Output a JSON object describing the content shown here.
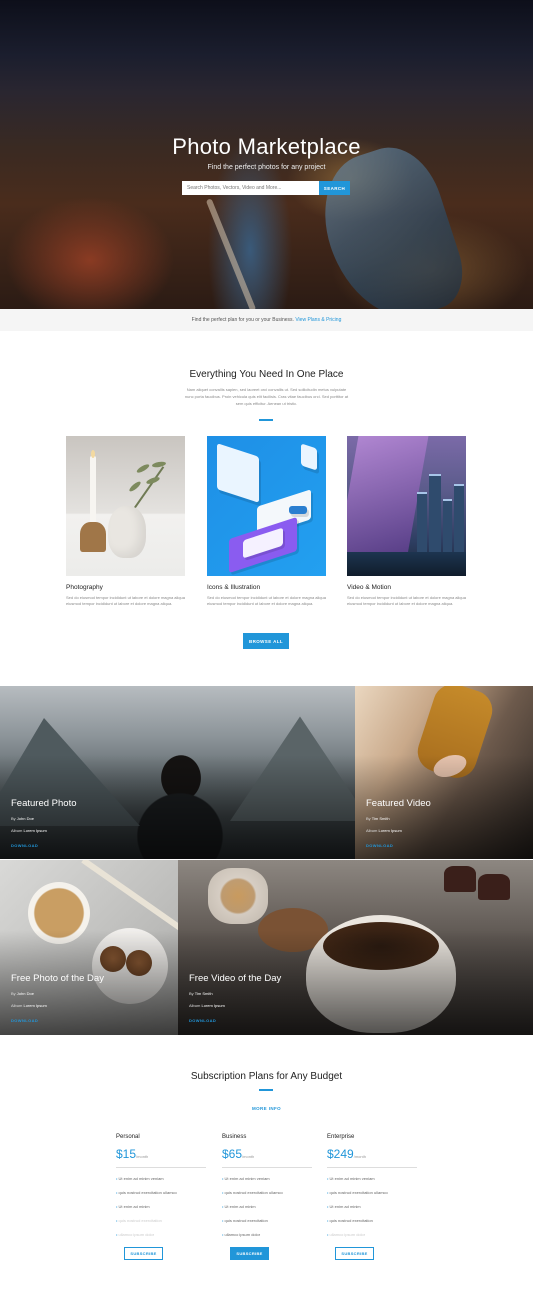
{
  "hero": {
    "title": "Photo Marketplace",
    "subtitle": "Find the perfect photos for any project",
    "search_placeholder": "Search Photos, Vectors, Video and More...",
    "search_button": "SEARCH"
  },
  "plans_bar": {
    "text": "Find the perfect plan for you or your Business.",
    "link": "View Plans & Pricing"
  },
  "features": {
    "title": "Everything You Need In One Place",
    "description": "Nam aliquet convallis sapien, sed laoreet orci convallis ut. Sed sollicitudin metus vulputate nunc porta faucibus. Proin vehicula quis elit facilisis. Cras vitae faucibus orci. Sed porttitor at sem quis efficitur. Aenean ut tristic.",
    "cards": [
      {
        "title": "Photography",
        "text": "Sed do eiusmod tempor incididunt ut labore et dolore magna aliqua eiusmod tempor incididunt ut labore et dolore magna aliqua."
      },
      {
        "title": "Icons & Illustration",
        "text": "Sed do eiusmod tempor incididunt ut labore et dolore magna aliqua eiusmod tempor incididunt ut labore et dolore magna aliqua."
      },
      {
        "title": "Video & Motion",
        "text": "Sed do eiusmod tempor incididunt ut labore et dolore magna aliqua eiusmod tempor incididunt ut labore et dolore magna aliqua."
      }
    ],
    "browse_button": "BROWSE ALL"
  },
  "featured": [
    {
      "title": "Featured Photo",
      "by_label": "By",
      "author": "John Doe",
      "album_label": "Album",
      "album": "Lorem Ipsum",
      "download": "DOWNLOAD"
    },
    {
      "title": "Featured Video",
      "by_label": "By",
      "author": "Tim Smith",
      "album_label": "Album",
      "album": "Lorem Ipsum",
      "download": "DOWNLOAD"
    },
    {
      "title": "Free Photo of the Day",
      "by_label": "By",
      "author": "John Doe",
      "album_label": "Album",
      "album": "Lorem Ipsum",
      "download": "DOWNLOAD"
    },
    {
      "title": "Free Video of the Day",
      "by_label": "By",
      "author": "Tim Smith",
      "album_label": "Album",
      "album": "Lorem Ipsum",
      "download": "DOWNLOAD"
    }
  ],
  "pricing": {
    "title": "Subscription Plans for Any Budget",
    "more_info": "MORE INFO",
    "plans": [
      {
        "name": "Personal",
        "price": "$15",
        "period": "/month",
        "features": [
          "Ut enim ad minim veniam",
          "quis nostrud exercitation ullamco",
          "Ut enim ad minim",
          "quis nostrud exercitation",
          "ullamco ipsum dolor"
        ],
        "button": "SUBSCRIBE"
      },
      {
        "name": "Business",
        "price": "$65",
        "period": "/month",
        "features": [
          "Ut enim ad minim veniam",
          "quis nostrud exercitation ullamco",
          "Ut enim ad minim",
          "quis nostrud exercitation",
          "ullamco ipsum dolor"
        ],
        "button": "SUBSCRIBE"
      },
      {
        "name": "Enterprise",
        "price": "$249",
        "period": "/month",
        "features": [
          "Ut enim ad minim veniam",
          "quis nostrud exercitation ullamco",
          "Ut enim ad minim",
          "quis nostrud exercitation",
          "ullamco ipsum dolor"
        ],
        "button": "SUBSCRIBE"
      }
    ]
  },
  "colors": {
    "accent": "#2196d9"
  }
}
